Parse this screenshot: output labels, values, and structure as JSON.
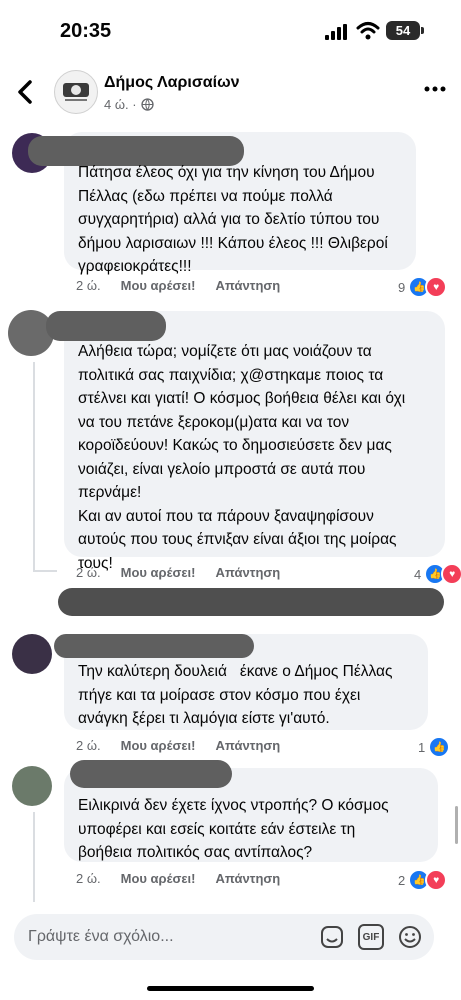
{
  "status_bar": {
    "time": "20:35",
    "battery": "54"
  },
  "header": {
    "page_name": "Δήμος Λαρισαίων",
    "age": "4 ώ. ·"
  },
  "comments": [
    {
      "text": "Πάτησα έλεος όχι για την κίνηση του Δήμου\nΠέλλας (εδω πρέπει να πούμε πολλά\nσυγχαρητήρια) αλλά για το δελτίο τύπου του\nδήμου λαρισαιων !!! Κάπου έλεος !!! Θλιβεροί\nγραφειοκράτες!!!",
      "age": "2 ώ.",
      "like": "Μου αρέσει!",
      "reply": "Απάντηση",
      "reactions": "9"
    },
    {
      "text": "Αλήθεια τώρα; νομίζετε ότι μας νοιάζουν τα\nπολιτικά σας παιχνίδια; χ@στηκαμε ποιος τα\nστέλνει και γιατί! Ο κόσμος βοήθεια θέλει και όχι\nνα του πετάνε ξεροκομ(μ)ατα και να τον\nκοροϊδεύουν! Κακώς το δημοσιεύσετε δεν μας\nνοιάζει, είναι γελοίο μπροστά σε αυτά που\nπερνάμε!\nΚαι αν αυτοί που τα πάρουν ξαναψηφίσουν\nαυτούς που τους έπνιξαν είναι άξιοι της μοίρας\nτους!",
      "age": "2 ώ.",
      "like": "Μου αρέσει!",
      "reply": "Απάντηση",
      "reactions": "4"
    },
    {
      "text": "Την καλύτερη δουλειά   έκανε ο Δήμος Πέλλας\nπήγε και τα μοίρασε στον κόσμο που έχει\nανάγκη ξέρει τι λαμόγια είστε γι'αυτό.",
      "age": "2 ώ.",
      "like": "Μου αρέσει!",
      "reply": "Απάντηση",
      "reactions": "1"
    },
    {
      "text": "Ειλικρινά δεν έχετε ίχνος ντροπής? Ο κόσμος\nυποφέρει και εσείς κοιτάτε εάν έστειλε τη\nβοήθεια πολιτικός σας αντίπαλος?",
      "age": "2 ώ.",
      "like": "Μου αρέσει!",
      "reply": "Απάντηση",
      "reactions": "2"
    }
  ],
  "input": {
    "placeholder": "Γράψτε ένα σχόλιο...",
    "gif_label": "GIF"
  },
  "colors": {
    "accent": "#1877f2",
    "bubble": "#f0f2f5",
    "heart": "#f33e58"
  }
}
